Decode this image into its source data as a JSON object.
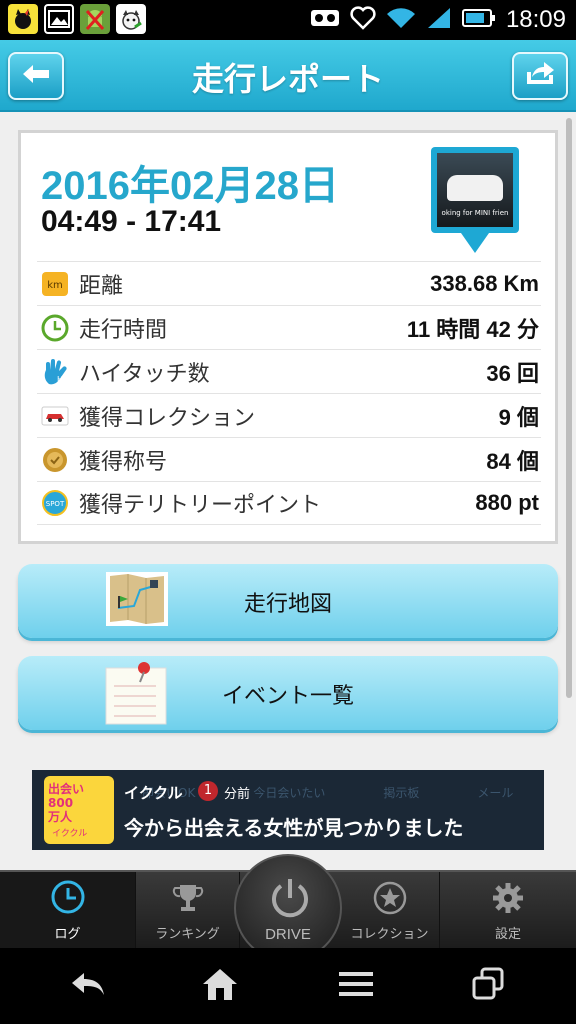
{
  "status_bar": {
    "time": "18:09",
    "left_icons": [
      "cat-app-icon",
      "gallery-icon",
      "android-app-icon",
      "dog-app-icon"
    ],
    "right_icons": [
      "voicemail-icon",
      "heart-app-icon",
      "wifi-icon",
      "signal-icon",
      "battery-icon"
    ]
  },
  "header": {
    "title": "走行レポート",
    "back_icon": "back-arrow-icon",
    "share_icon": "share-arrow-icon"
  },
  "report": {
    "date": "2016年02月28日",
    "time_range": "04:49 - 17:41",
    "photo_caption": "oking for MINI frien",
    "rows": [
      {
        "icon": "km-icon",
        "label": "距離",
        "value": "338.68 Km"
      },
      {
        "icon": "clock-icon",
        "label": "走行時間",
        "value": "11 時間 42 分"
      },
      {
        "icon": "hi-touch-icon",
        "label": "ハイタッチ数",
        "value": "36 回"
      },
      {
        "icon": "car-icon",
        "label": "獲得コレクション",
        "value": "9 個"
      },
      {
        "icon": "medal-icon",
        "label": "獲得称号",
        "value": "84 個"
      },
      {
        "icon": "spot-icon",
        "label": "獲得テリトリーポイント",
        "value": "880 pt"
      }
    ]
  },
  "buttons": {
    "map": "走行地図",
    "events": "イベント一覧"
  },
  "ad": {
    "logo_line1": "出会い",
    "logo_line2": "800",
    "logo_line3": "万人",
    "logo_sub": "イククル",
    "brand": "イククル",
    "badge": "1",
    "time": "分前",
    "message": "今から出会える女性が見つかりました",
    "background_items": [
      "即会いOK",
      "今日会いたい",
      "掲示板",
      "メール"
    ]
  },
  "tabs": {
    "log": "ログ",
    "ranking": "ランキング",
    "drive": "DRIVE",
    "collection": "コレクション",
    "settings": "設定"
  },
  "colors": {
    "accent": "#26a7cc",
    "header": "#2bb5d9",
    "button": "#8edcf2"
  }
}
